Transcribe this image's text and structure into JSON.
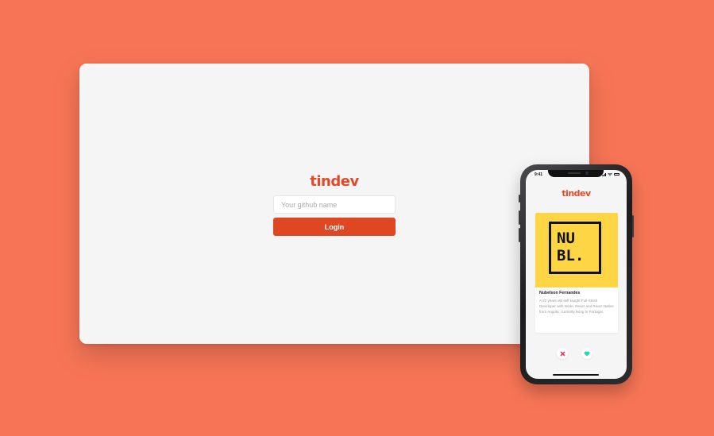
{
  "desktop": {
    "logo": "tindev",
    "username_placeholder": "Your github name",
    "login_label": "Login"
  },
  "phone": {
    "status_time": "9:41",
    "logo": "tindev",
    "card": {
      "avatar_text": "NU\nBL.",
      "name": "Nubelson Fernandes",
      "bio": "A 22 years old self taught Full-Stack Developer with Node, React and React Native from Angola, currently living in Portugal."
    },
    "actions": {
      "dislike_icon": "close-icon",
      "like_icon": "heart-icon"
    }
  },
  "colors": {
    "background": "#f77556",
    "brand": "#e24b2a",
    "button": "#df4723",
    "dislike": "#e8385a",
    "like": "#22d9b1",
    "avatar_bg": "#fdd545"
  }
}
